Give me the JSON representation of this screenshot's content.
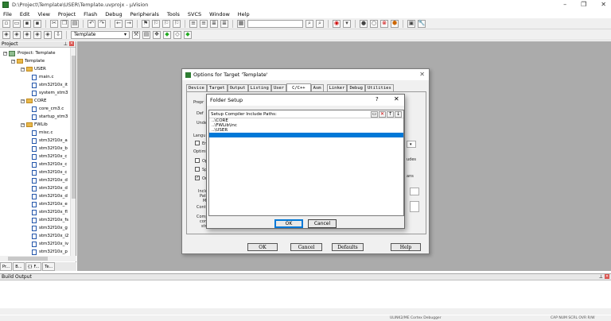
{
  "window": {
    "title": "D:\\Project\\Template\\USER\\Template.uvprojx - µVision",
    "controls": [
      "–",
      "❐",
      "✕"
    ]
  },
  "menu": [
    "File",
    "Edit",
    "View",
    "Project",
    "Flash",
    "Debug",
    "Peripherals",
    "Tools",
    "SVCS",
    "Window",
    "Help"
  ],
  "toolbar2": {
    "target": "Template"
  },
  "project_panel": {
    "title": "Project",
    "tree": [
      {
        "label": "Project: Template",
        "level": 0,
        "kind": "project"
      },
      {
        "label": "Template",
        "level": 1,
        "kind": "folder"
      },
      {
        "label": "USER",
        "level": 2,
        "kind": "folder"
      },
      {
        "label": "main.c",
        "level": 3,
        "kind": "file"
      },
      {
        "label": "stm32f10x_it",
        "level": 3,
        "kind": "file"
      },
      {
        "label": "system_stm3",
        "level": 3,
        "kind": "file"
      },
      {
        "label": "CORE",
        "level": 2,
        "kind": "folder"
      },
      {
        "label": "core_cm3.c",
        "level": 3,
        "kind": "file"
      },
      {
        "label": "startup_stm3",
        "level": 3,
        "kind": "file"
      },
      {
        "label": "FWLib",
        "level": 2,
        "kind": "folder"
      },
      {
        "label": "misc.c",
        "level": 3,
        "kind": "file"
      },
      {
        "label": "stm32f10x_a",
        "level": 3,
        "kind": "file"
      },
      {
        "label": "stm32f10x_b",
        "level": 3,
        "kind": "file"
      },
      {
        "label": "stm32f10x_c",
        "level": 3,
        "kind": "file"
      },
      {
        "label": "stm32f10x_c",
        "level": 3,
        "kind": "file"
      },
      {
        "label": "stm32f10x_c",
        "level": 3,
        "kind": "file"
      },
      {
        "label": "stm32f10x_d",
        "level": 3,
        "kind": "file"
      },
      {
        "label": "stm32f10x_d",
        "level": 3,
        "kind": "file"
      },
      {
        "label": "stm32f10x_d",
        "level": 3,
        "kind": "file"
      },
      {
        "label": "stm32f10x_e",
        "level": 3,
        "kind": "file"
      },
      {
        "label": "stm32f10x_fl",
        "level": 3,
        "kind": "file"
      },
      {
        "label": "stm32f10x_fs",
        "level": 3,
        "kind": "file"
      },
      {
        "label": "stm32f10x_g",
        "level": 3,
        "kind": "file"
      },
      {
        "label": "stm32f10x_i2",
        "level": 3,
        "kind": "file"
      },
      {
        "label": "stm32f10x_iv",
        "level": 3,
        "kind": "file"
      },
      {
        "label": "stm32f10x_p",
        "level": 3,
        "kind": "file"
      }
    ],
    "tabs": [
      "Pr...",
      "B...",
      "{} F...",
      "Te..."
    ]
  },
  "build_output": {
    "title": "Build Output"
  },
  "statusbar": {
    "left": "ULINK2/ME Cortex Debugger",
    "right": "CAP  NUM  SCRL  OVR  R/W"
  },
  "options_dialog": {
    "title": "Options for Target 'Template'",
    "tabs": [
      "Device",
      "Target",
      "Output",
      "Listing",
      "User",
      "C/C++",
      "Asm",
      "Linker",
      "Debug",
      "Utilities"
    ],
    "active_tab": "C/C++",
    "fragments": [
      "Prepr",
      "Def",
      "Undel",
      "Langu",
      "En",
      "Optimi",
      "Op",
      "Sp",
      "On",
      "Inclu",
      "Pat",
      "Mi",
      "Contr",
      "Compi",
      "contr",
      "strin",
      "udes",
      "ans"
    ],
    "buttons": {
      "ok": "OK",
      "cancel": "Cancel",
      "defaults": "Defaults",
      "help": "Help"
    }
  },
  "folder_dialog": {
    "title": "Folder Setup",
    "help": "?",
    "close": "✕",
    "list_header": "Setup Compiler Include Paths:",
    "entries": [
      "..\\CORE",
      "..\\FWLib\\inc",
      "..\\USER"
    ],
    "new_entry": "",
    "buttons": {
      "ok": "OK",
      "cancel": "Cancel"
    }
  }
}
